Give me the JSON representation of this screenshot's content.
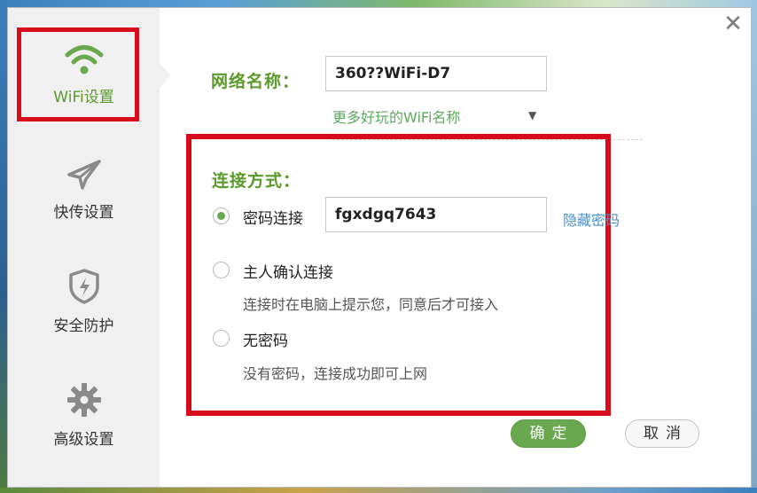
{
  "sidebar": {
    "items": [
      {
        "label": "WiFi设置",
        "icon": "wifi-icon",
        "active": true
      },
      {
        "label": "快传设置",
        "icon": "paper-plane-icon",
        "active": false
      },
      {
        "label": "安全防护",
        "icon": "shield-icon",
        "active": false
      },
      {
        "label": "高级设置",
        "icon": "gear-icon",
        "active": false
      }
    ]
  },
  "network": {
    "name_label": "网络名称：",
    "name_value": "360??WiFi-D7",
    "more_names_link": "更多好玩的WiFi名称"
  },
  "connection": {
    "label": "连接方式：",
    "options": [
      {
        "label": "密码连接",
        "checked": true
      },
      {
        "label": "主人确认连接",
        "desc": "连接时在电脑上提示您，同意后才可接入",
        "checked": false
      },
      {
        "label": "无密码",
        "desc": "没有密码，连接成功即可上网",
        "checked": false
      }
    ],
    "password_value": "fgxdgq7643",
    "hide_password_link": "隐藏密码"
  },
  "buttons": {
    "ok": "确定",
    "cancel": "取消"
  },
  "colors": {
    "accent_green": "#6aa84f",
    "highlight_red": "#d80b1a",
    "link_blue": "#4a90c8"
  }
}
